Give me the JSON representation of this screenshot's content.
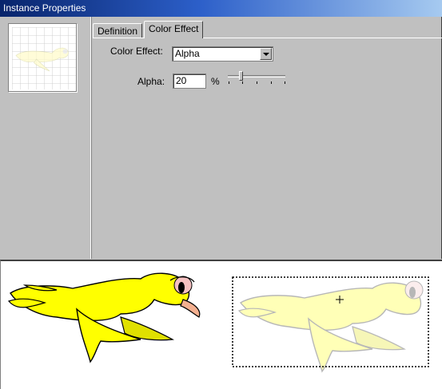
{
  "window": {
    "title": "Instance Properties"
  },
  "tabs": [
    {
      "label": "Definition",
      "active": false
    },
    {
      "label": "Color Effect",
      "active": true
    }
  ],
  "color_effect": {
    "label": "Color Effect:",
    "selected": "Alpha"
  },
  "alpha": {
    "label": "Alpha:",
    "value": "20",
    "unit": "%",
    "slider_fraction": 0.2
  },
  "colors": {
    "bird_body": "#ffff00",
    "bird_ghost": "#fffbcc",
    "title_start": "#08246b",
    "title_end": "#a6caf0"
  },
  "icons": [
    "bird-thumbnail",
    "crosshair-icon",
    "dropdown-arrow-icon"
  ]
}
